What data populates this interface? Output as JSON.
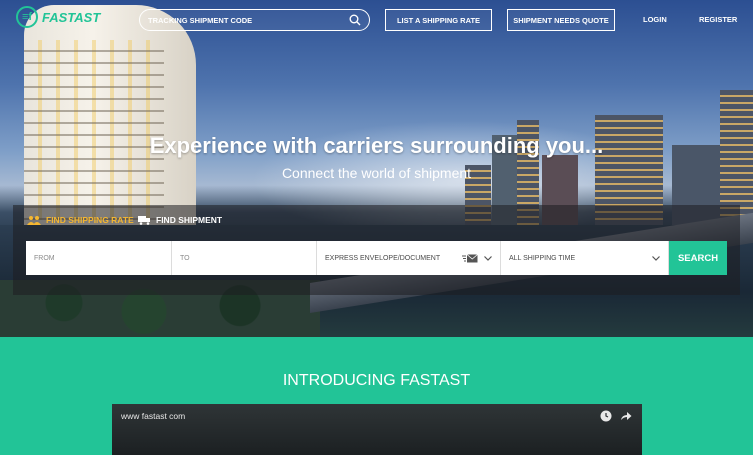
{
  "brand": {
    "name": "FASTAST",
    "mark": "≡f",
    "accent": "#22c497",
    "highlight": "#f5b731"
  },
  "nav": {
    "search_placeholder": "TRACKING SHIPMENT CODE",
    "list_rate": "LIST A SHIPPING RATE",
    "needs_quote": "SHIPMENT NEEDS QUOTE",
    "login": "LOGIN",
    "register": "REGISTER"
  },
  "hero": {
    "headline": "Experience with carriers surrounding you...",
    "subheadline": "Connect the world of shipment"
  },
  "search_panel": {
    "tabs": [
      {
        "label": "FIND SHIPPING RATE",
        "icon": "people-icon",
        "active": true
      },
      {
        "label": "FIND SHIPMENT",
        "icon": "truck-icon",
        "active": false
      }
    ],
    "from_placeholder": "FROM",
    "to_placeholder": "TO",
    "package_type": "EXPRESS ENVELOPE/DOCUMENT",
    "shipping_time": "ALL SHIPPING TIME",
    "search_label": "SEARCH"
  },
  "intro": {
    "title": "INTRODUCING FASTAST",
    "video_url": "www fastast com"
  }
}
